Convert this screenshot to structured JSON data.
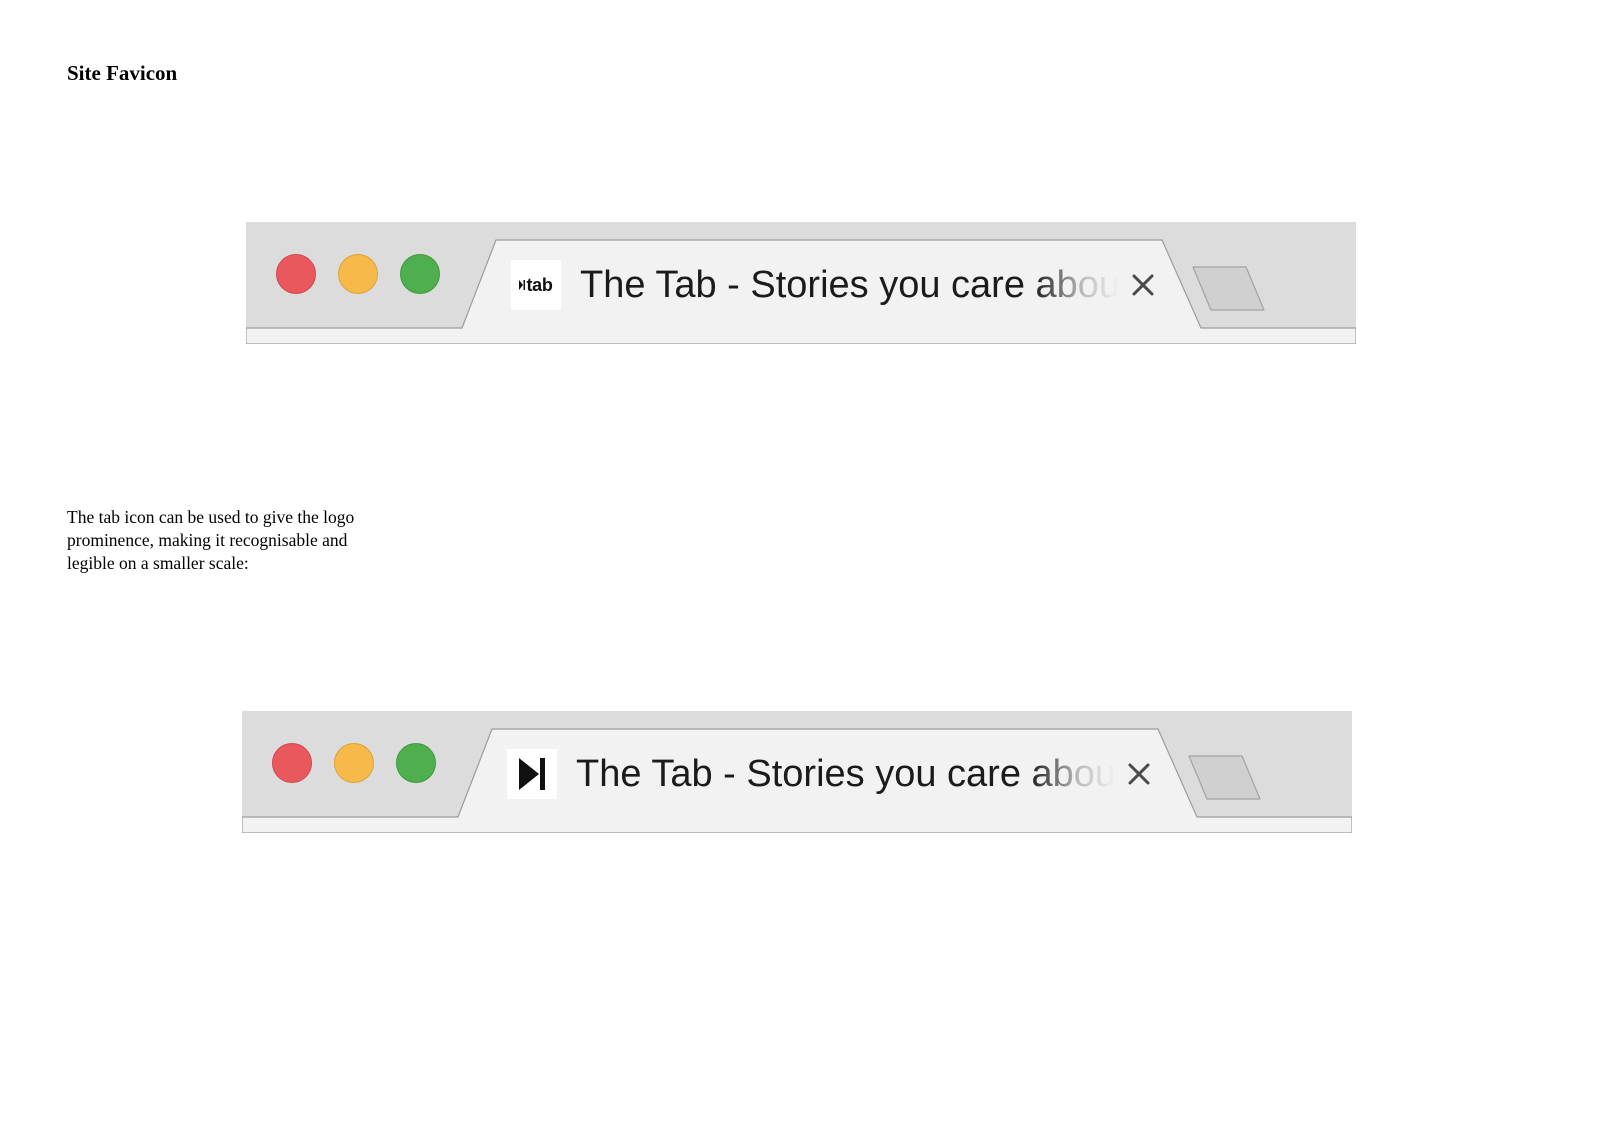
{
  "heading": "Site Favicon",
  "caption": "The tab icon can be used to give the logo prominence, making it recognisable and legible on a smaller scale:",
  "examples": [
    {
      "favicon_text": "tab",
      "favicon_icon": "the-tab-wordmark-icon",
      "tab_title": "The Tab - Stories you care about",
      "close_icon": "close-icon"
    },
    {
      "favicon_icon": "play-bar-logo-icon",
      "tab_title": "The Tab - Stories you care about",
      "close_icon": "close-icon"
    }
  ],
  "colors": {
    "traffic_red": "#e9585d",
    "traffic_yellow": "#f6b94a",
    "traffic_green": "#4fae4e",
    "tab_active": "#f2f2f2",
    "tab_bar": "#dcdcdc"
  }
}
